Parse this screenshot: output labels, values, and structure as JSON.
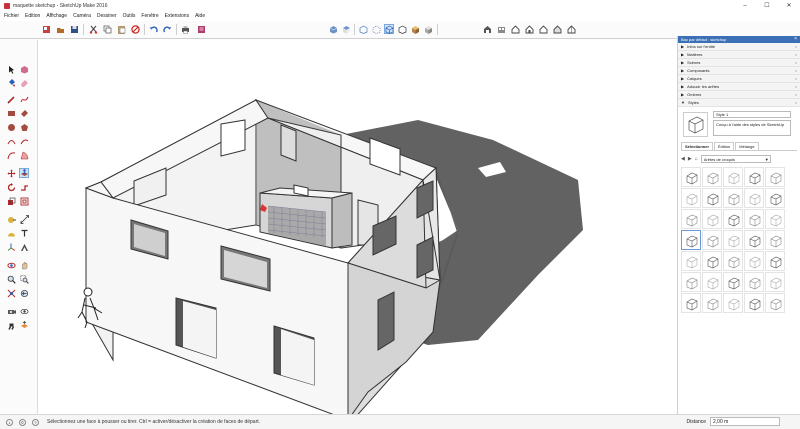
{
  "window": {
    "title": "maquette sketchup - SketchUp Make 2016",
    "minimize": "–",
    "maximize": "☐",
    "close": "✕"
  },
  "menu": [
    "Fichier",
    "Edition",
    "Affichage",
    "Caméra",
    "Dessiner",
    "Outils",
    "Fenêtre",
    "Extensions",
    "Aide"
  ],
  "status": {
    "message": "Sélectionnez une face à pousser ou tirer. Ctrl = activer/désactiver la création de faces de départ.",
    "measure_label": "Distance",
    "measure_value": "2,00 m"
  },
  "tray": {
    "title": "Bac par défaut : sketchup",
    "close": "×",
    "panels": [
      {
        "label": "Infos sur l'entité"
      },
      {
        "label": "Matières"
      },
      {
        "label": "Scènes"
      },
      {
        "label": "Composants"
      },
      {
        "label": "Calques"
      },
      {
        "label": "Adoucir les arêtes"
      },
      {
        "label": "Ombres"
      },
      {
        "label": "Styles",
        "expanded": true
      }
    ],
    "styles": {
      "name": "Style 1",
      "description": "Conçu à l'aide des styles de SketchUp",
      "tabs": [
        "Sélectionner",
        "Édition",
        "Mélange"
      ],
      "library": "Arêtes de croquis",
      "thumb_count": 35,
      "selected_index": 15
    }
  }
}
